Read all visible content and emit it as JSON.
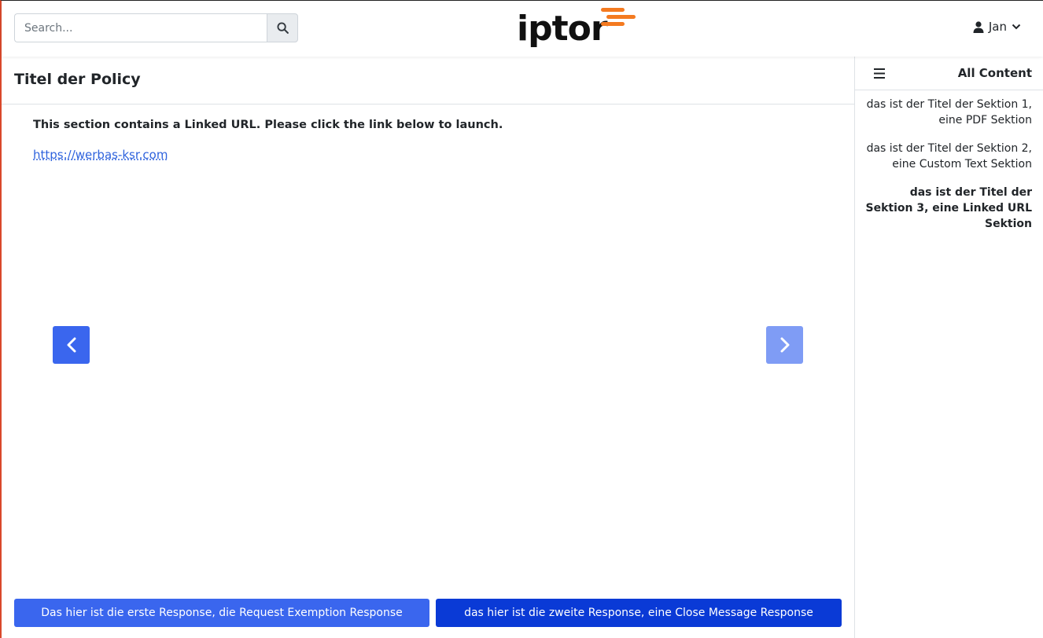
{
  "header": {
    "search_placeholder": "Search...",
    "logo_text": "iptor",
    "user_name": "Jan"
  },
  "main": {
    "policy_title": "Titel der Policy",
    "section_note": "This section contains a Linked URL. Please click the link below to launch.",
    "link_text": "https://werbas-ksr.com"
  },
  "responses": [
    {
      "label": "Das hier ist die erste Response, die Request Exemption Response"
    },
    {
      "label": "das hier ist die zweite Response, eine Close Message Response"
    }
  ],
  "sidebar": {
    "title": "All Content",
    "sections": [
      {
        "label": "das ist der Titel der Sektion 1, eine PDF Sektion",
        "active": false
      },
      {
        "label": "das ist der Titel der Sektion 2, eine Custom Text Sektion",
        "active": false
      },
      {
        "label": "das ist der Titel der Sektion 3, eine Linked URL Sektion",
        "active": true
      }
    ]
  },
  "colors": {
    "primary": "#3a66ee",
    "primary_dark": "#0a3ad6",
    "primary_light": "#7f9cf5",
    "logo_accent": "#f47a20",
    "link": "#2f63dd"
  }
}
